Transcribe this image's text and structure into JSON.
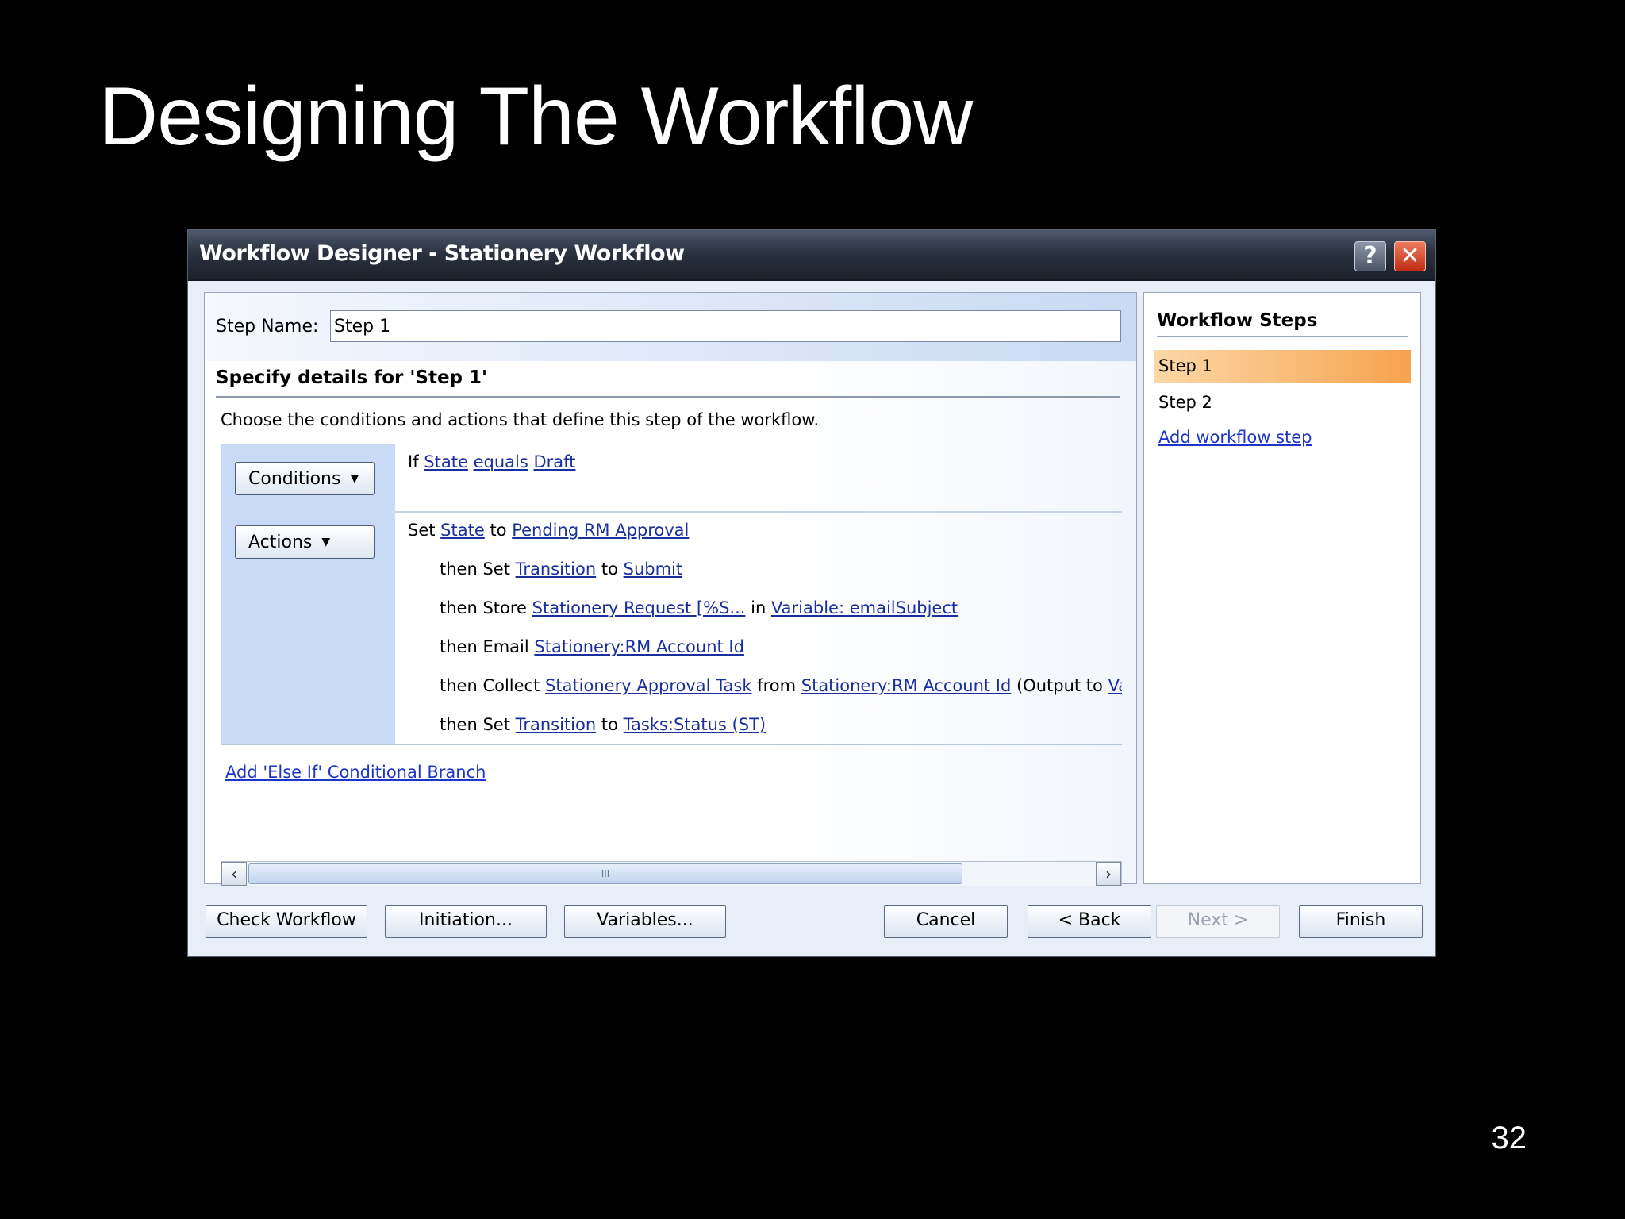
{
  "slide": {
    "title": "Designing The Workflow",
    "page_number": "32"
  },
  "dialog": {
    "title": "Workflow Designer - Stationery Workflow",
    "help_label": "?",
    "close_label": "✕",
    "step_name_label": "Step Name:",
    "step_name_value": "Step 1",
    "section_heading": "Specify details for 'Step 1'",
    "instructions": "Choose the conditions and actions that define this step of the workflow.",
    "conditions_button": "Conditions",
    "actions_button": "Actions",
    "condition": {
      "prefix": "If",
      "field": "State",
      "operator": "equals",
      "value": "Draft"
    },
    "actions": [
      {
        "parts": [
          "Set ",
          "State",
          " to ",
          "Pending RM Approval"
        ]
      },
      {
        "parts": [
          "then Set ",
          "Transition",
          " to ",
          "Submit"
        ]
      },
      {
        "parts": [
          "then Store ",
          "Stationery Request [%S...",
          " in ",
          "Variable: emailSubject"
        ]
      },
      {
        "parts": [
          "then Email ",
          "Stationery:RM Account Id"
        ]
      },
      {
        "parts": [
          "then Collect ",
          "Stationery Approval Task",
          " from ",
          "Stationery:RM Account Id",
          " (Output to ",
          "Va"
        ]
      },
      {
        "parts": [
          "then Set ",
          "Transition",
          " to ",
          "Tasks:Status (ST)"
        ]
      }
    ],
    "add_branch_link": "Add 'Else If' Conditional Branch",
    "scroll_thumb_grip": "III",
    "workflow_steps": {
      "heading": "Workflow Steps",
      "items": [
        "Step 1",
        "Step 2"
      ],
      "selected": "Step 1",
      "add_link": "Add workflow step"
    },
    "buttons": {
      "check_workflow": "Check Workflow",
      "initiation": "Initiation...",
      "variables": "Variables...",
      "cancel": "Cancel",
      "back": "< Back",
      "next": "Next >",
      "finish": "Finish"
    }
  },
  "colors": {
    "background": "#000000",
    "selected_step": "#f9b36a",
    "link": "#1d35c8",
    "rules_column": "#c9daf6"
  }
}
